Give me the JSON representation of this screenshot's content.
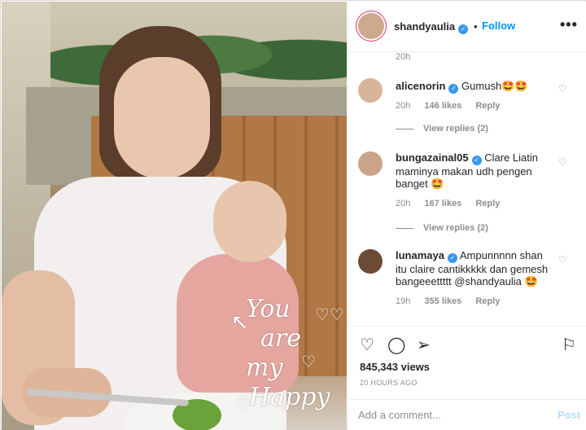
{
  "post": {
    "author": "shandyaulia",
    "follow_label": "Follow",
    "more_icon": "more-icon",
    "overlay_text": [
      "You",
      "are",
      "my",
      "Happy"
    ]
  },
  "comments": {
    "previous_time": "20h",
    "items": [
      {
        "user": "alicenorin",
        "text": "Gumush🤩🤩",
        "time": "20h",
        "likes": "146 likes",
        "reply": "Reply",
        "view_replies": "View replies (2)"
      },
      {
        "user": "bungazainal05",
        "text": "Clare Liatin maminya makan udh pengen banget 🤩",
        "time": "20h",
        "likes": "167 likes",
        "reply": "Reply",
        "view_replies": "View replies (2)"
      },
      {
        "user": "lunamaya",
        "text": "Ampunnnnn shan itu claire cantikkkkk dan gemesh bangeeettttt @shandyaulia 🤩",
        "time": "19h",
        "likes": "355 likes",
        "reply": "Reply"
      }
    ]
  },
  "stats": {
    "views": "845,343 views",
    "timestamp": "20 HOURS AGO"
  },
  "add_comment": {
    "placeholder": "Add a comment...",
    "post_label": "Post"
  },
  "colors": {
    "accent": "#0095f6",
    "verified": "#3897f0",
    "muted": "#8e8e8e",
    "post_disabled": "#b2dffc"
  }
}
